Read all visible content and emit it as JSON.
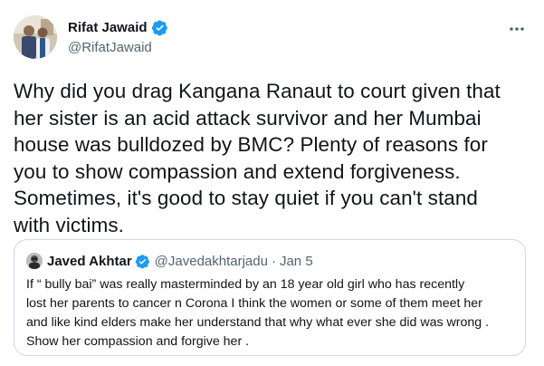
{
  "author": {
    "display_name": "Rifat Jawaid",
    "handle": "@RifatJawaid",
    "verified": true,
    "avatar_icon": "profile-photo-two-men"
  },
  "more_icon": "more-dots-icon",
  "tweet": {
    "lines": [
      "Why did you drag Kangana Ranaut to court given that",
      "her sister is an acid attack survivor and her Mumbai",
      "house was bulldozed by BMC? Plenty of reasons for",
      "you to show compassion and extend forgiveness.",
      "Sometimes, it's good to stay quiet if you can't stand",
      "with victims."
    ]
  },
  "quoted_tweet": {
    "display_name": "Javed Akhtar",
    "handle": "@Javedakhtarjadu",
    "separator": "·",
    "date": "Jan 5",
    "verified": true,
    "lines": [
      "If “ bully bai” was really masterminded by an 18 year old girl who has recently",
      "lost her parents to cancer n Corona  I think the women or some of them meet her",
      "and like kind elders make her understand that why what ever she did was wrong .",
      "Show her  compassion and forgive her ."
    ]
  },
  "colors": {
    "text_primary": "#0f1419",
    "text_secondary": "#536471",
    "verified_blue": "#1d9bf0",
    "border": "#cfd9de"
  }
}
